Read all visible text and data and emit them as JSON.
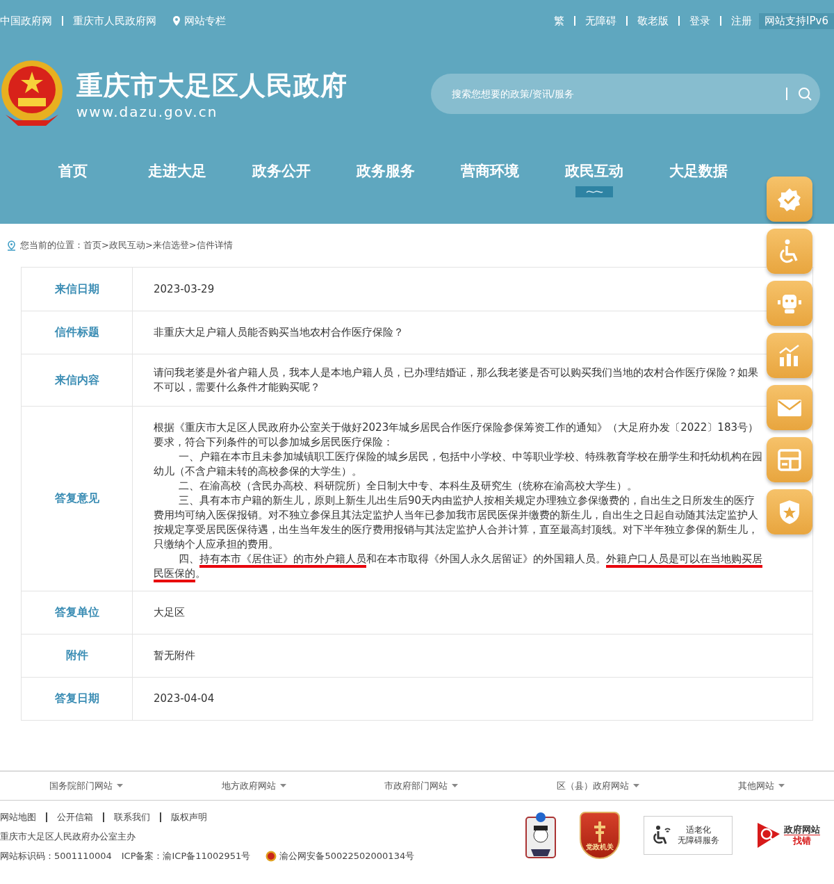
{
  "top_bar": {
    "left_links": [
      "中国政府网",
      "重庆市人民政府网"
    ],
    "column_link": "网站专栏",
    "right_links": [
      "繁",
      "无障碍",
      "敬老版",
      "登录",
      "注册"
    ],
    "ipv6_badge": "网站支持IPv6"
  },
  "header": {
    "site_title": "重庆市大足区人民政府",
    "domain": "www.dazu.gov.cn",
    "search": {
      "placeholder": "搜索您想要的政策/资讯/服务"
    }
  },
  "nav": [
    {
      "label": "首页",
      "selected": false
    },
    {
      "label": "走进大足",
      "selected": false
    },
    {
      "label": "政务公开",
      "selected": false
    },
    {
      "label": "政务服务",
      "selected": false
    },
    {
      "label": "营商环境",
      "selected": false
    },
    {
      "label": "政民互动",
      "selected": true
    },
    {
      "label": "大足数据",
      "selected": false
    }
  ],
  "breadcrumb": "您当前的位置：首页>政民互动>来信选登>信件详情",
  "letter": [
    {
      "label": "来信日期",
      "kind": "text",
      "value": "2023-03-29"
    },
    {
      "label": "信件标题",
      "kind": "text",
      "value": "非重庆大足户籍人员能否购买当地农村合作医疗保险？"
    },
    {
      "label": "来信内容",
      "kind": "text",
      "value": "请问我老婆是外省户籍人员，我本人是本地户籍人员，已办理结婚证，那么我老婆是否可以购买我们当地的农村合作医疗保险？如果不可以，需要什么条件才能购买呢？"
    },
    {
      "label": "答复意见",
      "kind": "reply",
      "paragraphs": [
        {
          "indent": false,
          "segments": [
            {
              "text": "根据《重庆市大足区人民政府办公室关于做好2023年城乡居民合作医疗保险参保筹资工作的通知》（大足府办发〔2022〕183号）要求，符合下列条件的可以参加城乡居民医疗保险：",
              "underlined": false
            }
          ]
        },
        {
          "indent": true,
          "segments": [
            {
              "text": "一、户籍在本市且未参加城镇职工医疗保险的城乡居民，包括中小学校、中等职业学校、特殊教育学校在册学生和托幼机构在园幼儿（不含户籍未转的高校参保的大学生）。",
              "underlined": false
            }
          ]
        },
        {
          "indent": true,
          "segments": [
            {
              "text": "二、在渝高校（含民办高校、科研院所）全日制大中专、本科生及研究生（统称在渝高校大学生）。",
              "underlined": false
            }
          ]
        },
        {
          "indent": true,
          "segments": [
            {
              "text": "三、具有本市户籍的新生儿，原则上新生儿出生后90天内由监护人按相关规定办理独立参保缴费的，自出生之日所发生的医疗费用均可纳入医保报销。对不独立参保且其法定监护人当年已参加我市居民医保并缴费的新生儿，自出生之日起自动随其法定监护人按规定享受居民医保待遇，出生当年发生的医疗费用报销与其法定监护人合并计算，直至最高封顶线。对下半年独立参保的新生儿，只缴纳个人应承担的费用。",
              "underlined": false
            }
          ]
        },
        {
          "indent": true,
          "segments": [
            {
              "text": "四、",
              "underlined": false
            },
            {
              "text": "持有本市《居住证》的市外户籍人员",
              "underlined": true
            },
            {
              "text": "和在本市取得《外国人永久居留证》的外国籍人员。",
              "underlined": false
            },
            {
              "text": "外籍户口人员是可以在当地购买居民医保的",
              "underlined": true
            },
            {
              "text": "。",
              "underlined": false
            }
          ]
        }
      ]
    },
    {
      "label": "答复单位",
      "kind": "text",
      "value": "大足区"
    },
    {
      "label": "附件",
      "kind": "text",
      "value": "暂无附件"
    },
    {
      "label": "答复日期",
      "kind": "text",
      "value": "2023-04-04"
    }
  ],
  "footer": {
    "site_groups": [
      "国务院部门网站",
      "地方政府网站",
      "市政府部门网站",
      "区（县）政府网站",
      "其他网站"
    ],
    "links": [
      "网站地图",
      "公开信箱",
      "联系我们",
      "版权声明"
    ],
    "sponsor": "重庆市大足区人民政府办公室主办",
    "site_code": "网站标识码：5001110004",
    "icp": "ICP备案：渝ICP备11002951号",
    "police_record": "渝公网安备50022502000134号",
    "badges": {
      "party": "党政机关",
      "elderly": [
        "适老化",
        "无障碍服务"
      ],
      "error": [
        "政府网站",
        "找错"
      ]
    }
  }
}
